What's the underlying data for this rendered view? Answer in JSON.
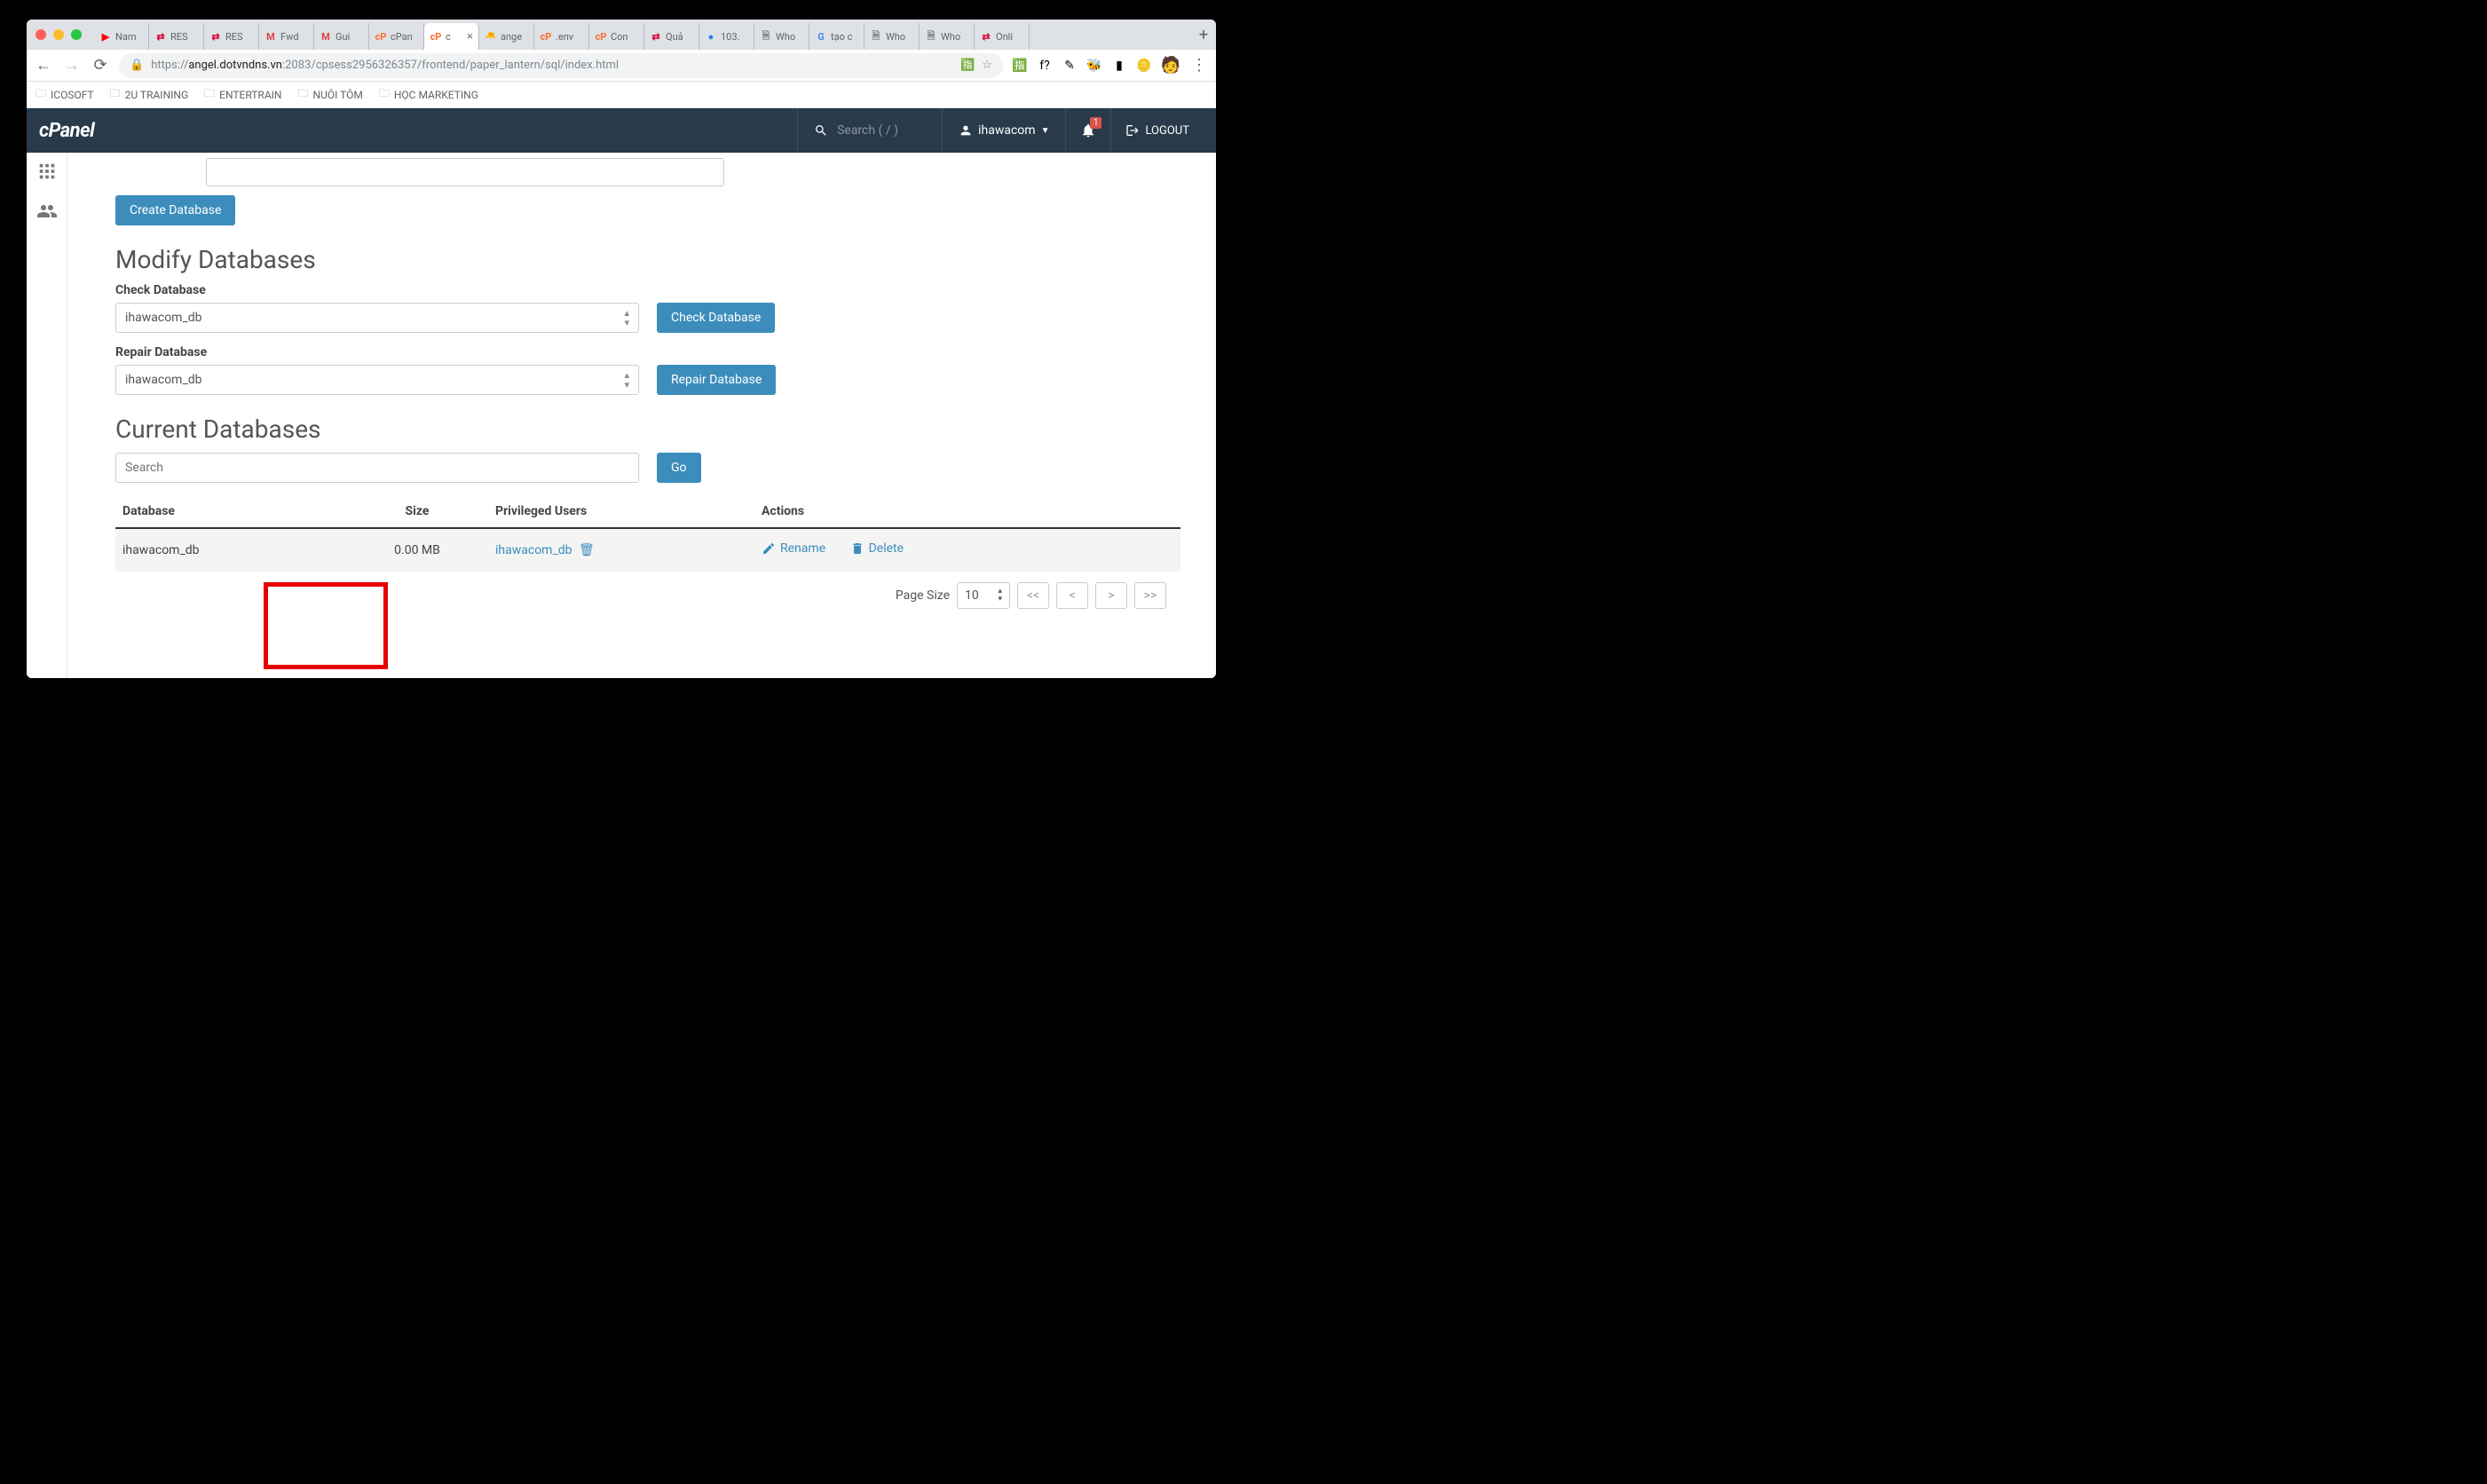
{
  "browser": {
    "tabs": [
      {
        "fav": "▶",
        "favcolor": "#ff0000",
        "label": "Nam"
      },
      {
        "fav": "⇄",
        "favcolor": "#d03",
        "label": "RES"
      },
      {
        "fav": "⇄",
        "favcolor": "#d03",
        "label": "RES"
      },
      {
        "fav": "M",
        "favcolor": "#d44",
        "label": "Fwd"
      },
      {
        "fav": "M",
        "favcolor": "#d44",
        "label": "Gui"
      },
      {
        "fav": "cP",
        "favcolor": "#ff6c2c",
        "label": "cPan"
      },
      {
        "fav": "cP",
        "favcolor": "#ff6c2c",
        "label": "c",
        "active": true
      },
      {
        "fav": "🐣",
        "favcolor": "#f5a623",
        "label": "ange"
      },
      {
        "fav": "cP",
        "favcolor": "#ff6c2c",
        "label": ".env"
      },
      {
        "fav": "cP",
        "favcolor": "#ff6c2c",
        "label": "Con"
      },
      {
        "fav": "⇄",
        "favcolor": "#d03",
        "label": "Quả"
      },
      {
        "fav": "●",
        "favcolor": "#2b7de9",
        "label": "103."
      },
      {
        "fav": "🗎",
        "favcolor": "#888",
        "label": "Who"
      },
      {
        "fav": "G",
        "favcolor": "#4285f4",
        "label": "tạo c"
      },
      {
        "fav": "🗎",
        "favcolor": "#888",
        "label": "Who"
      },
      {
        "fav": "🗎",
        "favcolor": "#888",
        "label": "Who"
      },
      {
        "fav": "⇄",
        "favcolor": "#d03",
        "label": "Onli"
      }
    ],
    "url_prefix": "https://",
    "url_host": "angel.dotvndns.vn",
    "url_path": ":2083/cpsess2956326357/frontend/paper_lantern/sql/index.html",
    "bookmarks": [
      "ICOSOFT",
      "2U TRAINING",
      "ENTERTRAIN",
      "NUÔI TÔM",
      "HỌC MARKETING"
    ],
    "ext_icons": [
      "🈯",
      "f?",
      "✎",
      "🐝",
      "▮",
      "🪙"
    ]
  },
  "cpanel": {
    "logo": "cPanel",
    "search_placeholder": "Search ( / )",
    "user": "ihawacom",
    "notif_count": "1",
    "logout": "LOGOUT",
    "create_btn": "Create Database",
    "modify_heading": "Modify Databases",
    "check_label": "Check Database",
    "check_value": "ihawacom_db",
    "check_btn": "Check Database",
    "repair_label": "Repair Database",
    "repair_value": "ihawacom_db",
    "repair_btn": "Repair Database",
    "current_heading": "Current Databases",
    "search_placeholder2": "Search",
    "go_btn": "Go",
    "cols": {
      "db": "Database",
      "size": "Size",
      "users": "Privileged Users",
      "actions": "Actions"
    },
    "row": {
      "db": "ihawacom_db",
      "size": "0.00 MB",
      "user": "ihawacom_db",
      "rename": "Rename",
      "delete": "Delete"
    },
    "page_size_label": "Page Size",
    "page_size": "10"
  }
}
